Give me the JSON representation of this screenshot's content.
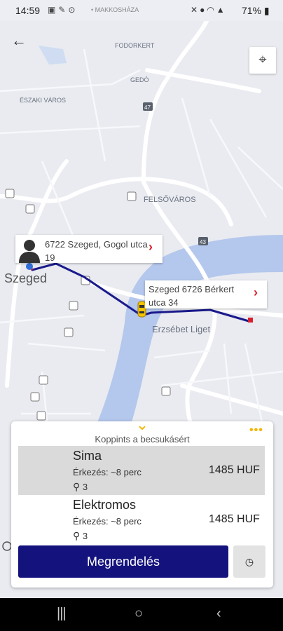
{
  "status_bar": {
    "time": "14:59",
    "carrier": "MAKKOSHÁZA",
    "battery": "71%",
    "left_icons": [
      "image-icon",
      "wrench-icon",
      "location-icon"
    ],
    "right_icons": [
      "mute-icon",
      "location-icon",
      "wifi-icon",
      "signal-icon"
    ]
  },
  "map": {
    "labels": {
      "fodorkert": "FODORKERT",
      "gedo": "GEDÓ",
      "eszaki_varos": "ÉSZAKI VÁROS",
      "felsovaros": "FELSŐVÁROS",
      "szeged": "Szeged",
      "erzsebet_liget": "Erzsébet Liget",
      "road_47": "47",
      "road_43": "43"
    },
    "from_address": "6722 Szeged, Gogol utca 19",
    "to_address": "Szeged 6726 Bérkert utca 34"
  },
  "panel": {
    "collapse_hint": "Koppints a becsukásért",
    "more": "•••",
    "options": [
      {
        "name": "Sima",
        "eta": "Érkezés: ~8 perc",
        "price": "1485 HUF",
        "seats": "3"
      },
      {
        "name": "Elektromos",
        "eta": "Érkezés: ~8 perc",
        "price": "1485 HUF",
        "seats": "3"
      }
    ],
    "order_label": "Megrendelés"
  },
  "colors": {
    "route": "#1a1a8c",
    "order_button": "#14137e",
    "accent": "#f4b400",
    "river": "#b4c7ec"
  }
}
